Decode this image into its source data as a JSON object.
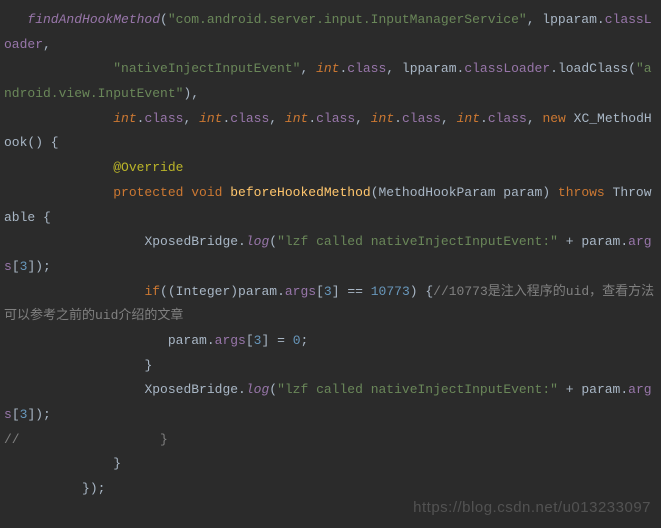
{
  "code": {
    "l1a": "findAndHookMethod",
    "l1b": "(",
    "l1c": "\"com.android.server.input.InputManagerService\"",
    "l1d": ", lpparam.",
    "l1e": "classLoader",
    "l1f": ",",
    "l2a": "\"nativeInjectInputEvent\"",
    "l2b": ", ",
    "l2c": "int",
    "l2d": ".",
    "l2e": "class",
    "l2f": ", lpparam.",
    "l2g": "classLoader",
    "l2h": ".loadClass(",
    "l2i": "\"android.view.InputEvent\"",
    "l2j": "),",
    "l3a": "int",
    "l3b": ".",
    "l3c": "class",
    "l3d": ", ",
    "l3e": "new ",
    "l3f": "XC_MethodHook",
    "l3g": "() {",
    "l4a": "@Override",
    "l5a": "protected void ",
    "l5b": "beforeHookedMethod",
    "l5c": "(MethodHookParam param) ",
    "l5d": "throws ",
    "l5e": "Throwable {",
    "l6a": "XposedBridge.",
    "l6b": "log",
    "l6c": "(",
    "l6d": "\"lzf called nativeInjectInputEvent:\"",
    "l6e": " + param.",
    "l6f": "args",
    "l6g": "[",
    "l6h": "3",
    "l6i": "]);",
    "l7a": "if",
    "l7b": "((Integer)param.",
    "l7c": "args",
    "l7d": "[",
    "l7e": "3",
    "l7f": "] == ",
    "l7g": "10773",
    "l7h": ") {",
    "l7i": "//10773是注入程序的uid，查看方法可以参考之前的uid介绍的文章",
    "l8a": "param.",
    "l8b": "args",
    "l8c": "[",
    "l8d": "3",
    "l8e": "] = ",
    "l8f": "0",
    "l8g": ";",
    "l9a": "}",
    "l10a": "XposedBridge.",
    "l10b": "log",
    "l10c": "(",
    "l10d": "\"lzf called nativeInjectInputEvent:\"",
    "l10e": " + param.",
    "l10f": "args",
    "l10g": "[",
    "l10h": "3",
    "l10i": "]);",
    "l11a": "//                  }",
    "l12a": "}",
    "l13a": "});"
  },
  "watermark": "https://blog.csdn.net/u013233097"
}
